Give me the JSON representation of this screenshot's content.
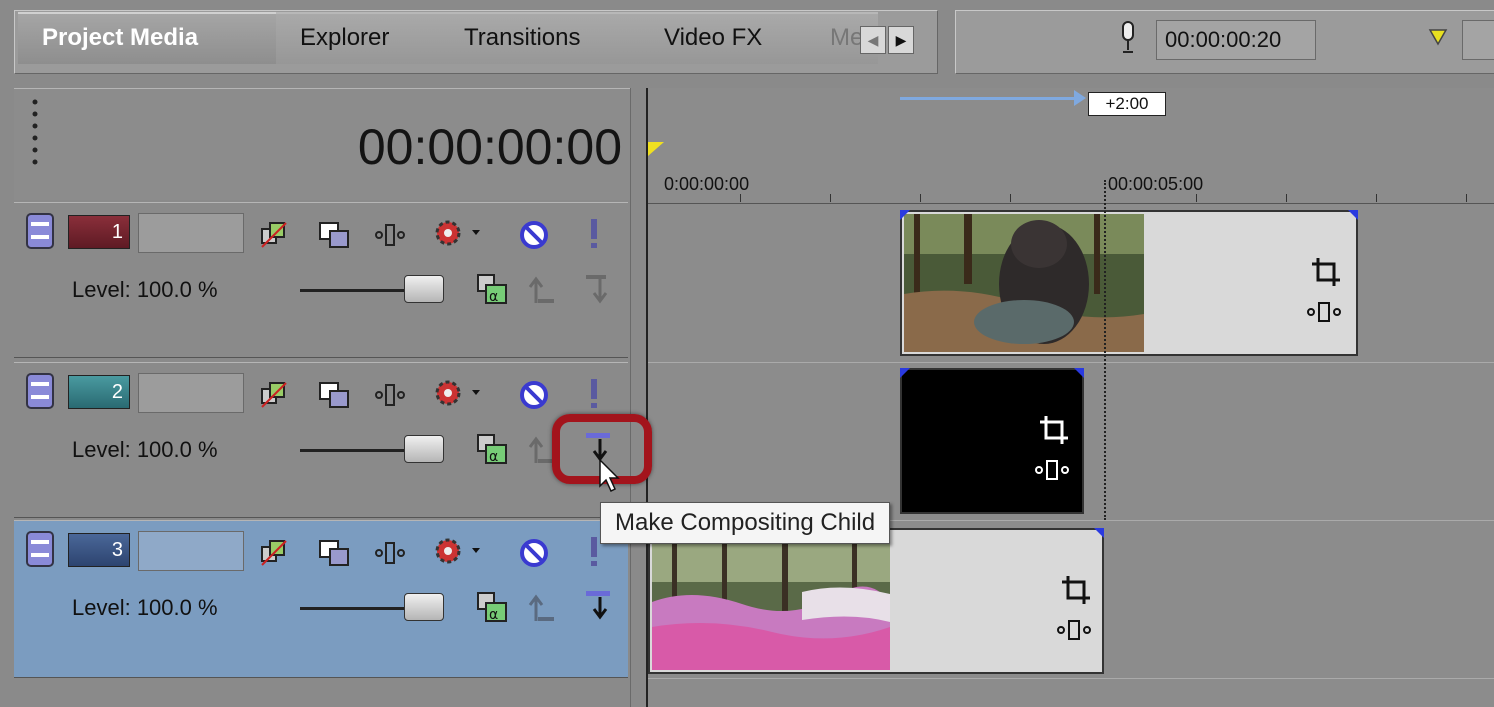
{
  "tabs": [
    {
      "label": "Project Media",
      "active": true
    },
    {
      "label": "Explorer",
      "active": false
    },
    {
      "label": "Transitions",
      "active": false
    },
    {
      "label": "Video FX",
      "active": false
    },
    {
      "label": "Me",
      "active": false
    }
  ],
  "preview": {
    "time": "00:00:00:20"
  },
  "timecode": "00:00:00:00",
  "loop_region": {
    "label": "+2:00"
  },
  "ruler": {
    "labels": [
      "0:00:00:00",
      "00:00:05:00"
    ]
  },
  "tracks": [
    {
      "number": "1",
      "level_label": "Level: 100.0 %",
      "level_percent": 100,
      "color": "#7a2632"
    },
    {
      "number": "2",
      "level_label": "Level: 100.0 %",
      "level_percent": 100,
      "color": "#3a8a92"
    },
    {
      "number": "3",
      "level_label": "Level: 100.0 %",
      "level_percent": 100,
      "color": "#3e5a8c",
      "selected": true
    }
  ],
  "tooltip": {
    "text": "Make Compositing Child"
  },
  "colors": {
    "highlight": "#a3141c",
    "selected_track": "#7b9cc0",
    "loop_bar": "#7fa9e0"
  }
}
